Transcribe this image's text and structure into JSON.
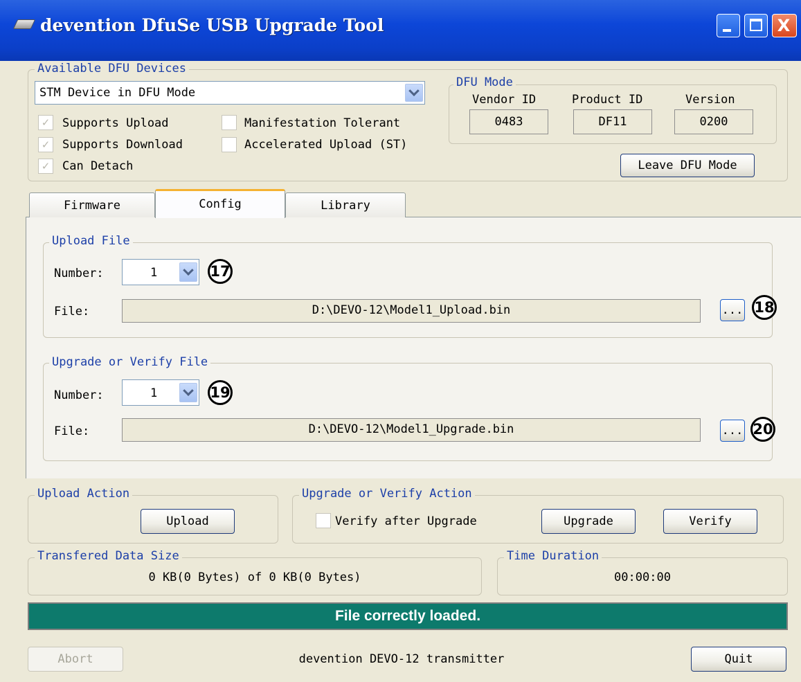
{
  "window": {
    "title": "devention DfuSe USB Upgrade Tool",
    "controls": [
      "minimize",
      "maximize",
      "close"
    ],
    "close_glyph": "X"
  },
  "devices": {
    "legend": "Available DFU Devices",
    "selected": "STM Device in DFU Mode",
    "checks": [
      {
        "label": "Supports Upload",
        "checked": true,
        "enabled": false
      },
      {
        "label": "Supports Download",
        "checked": true,
        "enabled": false
      },
      {
        "label": "Can Detach",
        "checked": true,
        "enabled": false
      },
      {
        "label": "Manifestation Tolerant",
        "checked": false,
        "enabled": false
      },
      {
        "label": "Accelerated Upload (ST)",
        "checked": false,
        "enabled": false
      }
    ]
  },
  "dfu_mode": {
    "legend": "DFU Mode",
    "vendor_label": "Vendor ID",
    "vendor_value": "0483",
    "product_label": "Product ID",
    "product_value": "DF11",
    "version_label": "Version",
    "version_value": "0200",
    "leave_button": "Leave DFU Mode"
  },
  "tabs": [
    {
      "label": "Firmware",
      "active": false
    },
    {
      "label": "Config",
      "active": true
    },
    {
      "label": "Library",
      "active": false
    }
  ],
  "upload_file": {
    "legend": "Upload File",
    "number_label": "Number:",
    "number_value": "1",
    "number_marker": "17",
    "file_label": "File:",
    "file_path": "D:\\DEVO-12\\Model1_Upload.bin",
    "browse_label": "...",
    "browse_marker": "18"
  },
  "upgrade_file": {
    "legend": "Upgrade or Verify File",
    "number_label": "Number:",
    "number_value": "1",
    "number_marker": "19",
    "file_label": "File:",
    "file_path": "D:\\DEVO-12\\Model1_Upgrade.bin",
    "browse_label": "...",
    "browse_marker": "20"
  },
  "upload_action": {
    "legend": "Upload Action",
    "button": "Upload"
  },
  "upgrade_action": {
    "legend": "Upgrade or Verify Action",
    "verify_after_label": "Verify after Upgrade",
    "verify_after_checked": false,
    "upgrade_button": "Upgrade",
    "verify_button": "Verify"
  },
  "transfer": {
    "legend": "Transfered Data Size",
    "value": "0 KB(0 Bytes) of 0 KB(0 Bytes)"
  },
  "duration": {
    "legend": "Time Duration",
    "value": "00:00:00"
  },
  "status": {
    "message": "File correctly loaded.",
    "color": "#0d7a6c"
  },
  "footer": {
    "abort_button": "Abort",
    "device_name": "devention DEVO-12 transmitter",
    "quit_button": "Quit"
  },
  "colors": {
    "titlebar": "#0d46d8",
    "legend": "#1c3fa8",
    "window_bg": "#ece9d8",
    "tab_highlight": "#f5b232"
  }
}
